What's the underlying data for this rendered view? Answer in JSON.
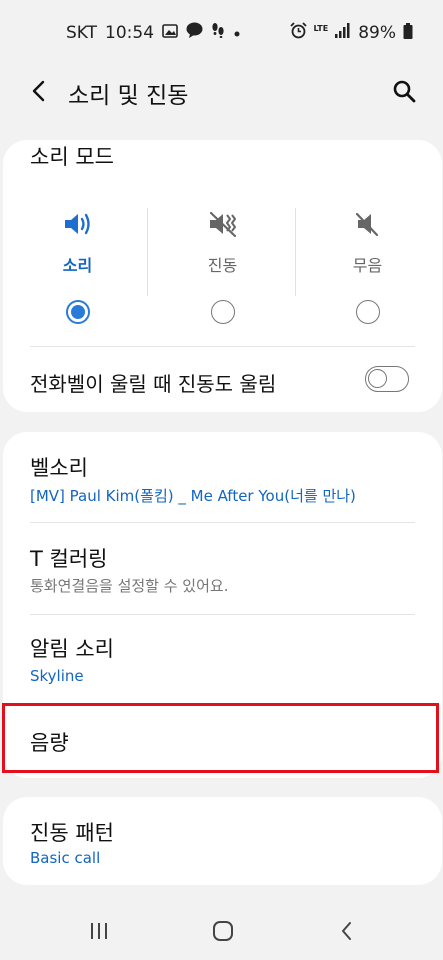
{
  "status_bar": {
    "carrier": "SKT",
    "time": "10:54",
    "signal": "LTE",
    "battery": "89%"
  },
  "app_bar": {
    "title": "소리 및 진동"
  },
  "sound_mode": {
    "title": "소리 모드",
    "options": [
      {
        "label": "소리",
        "icon": "sound-icon",
        "selected": true
      },
      {
        "label": "진동",
        "icon": "vibrate-icon",
        "selected": false
      },
      {
        "label": "무음",
        "icon": "mute-icon",
        "selected": false
      }
    ],
    "vibrate_while_ringing": {
      "label": "전화벨이 울릴 때 진동도 울림",
      "enabled": false
    }
  },
  "settings": [
    {
      "title": "벨소리",
      "subtitle": "[MV] Paul Kim(폴킴) _ Me After You(너를 만나)"
    },
    {
      "title": "T 컬러링",
      "subtitle": "통화연결음을 설정할 수 있어요."
    },
    {
      "title": "알림 소리",
      "subtitle": "Skyline"
    },
    {
      "title": "음량"
    }
  ],
  "vibration_pattern": {
    "title": "진동 패턴",
    "subtitle": "Basic call"
  },
  "colors": {
    "accent": "#2a7ad9",
    "link": "#1266c0",
    "highlight": "#e3101c"
  }
}
